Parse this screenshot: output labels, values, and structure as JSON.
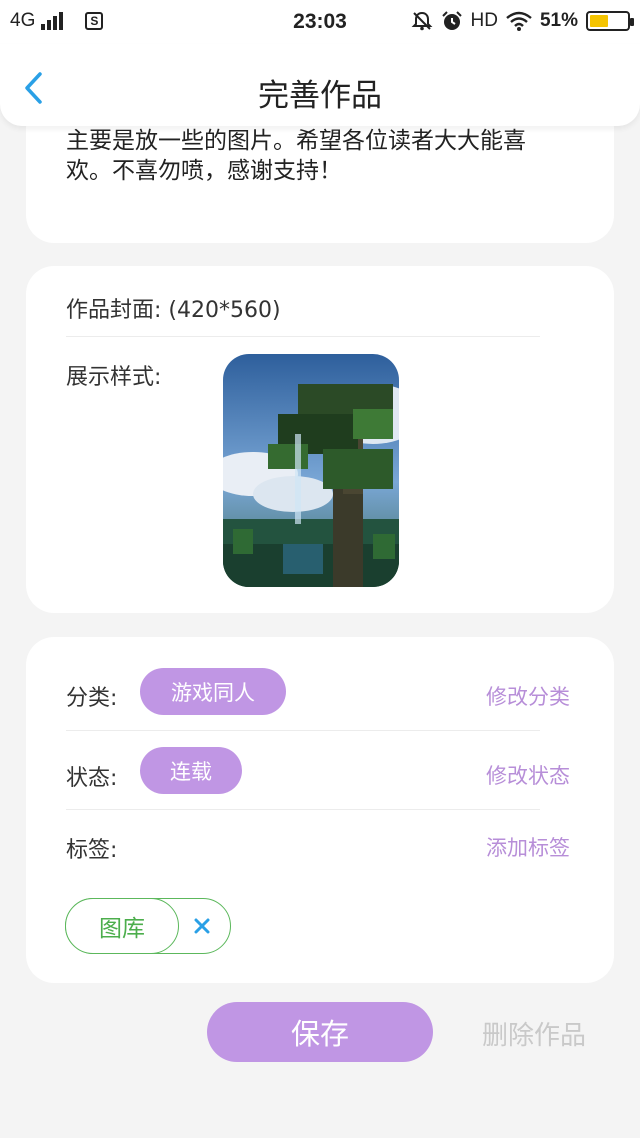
{
  "status_bar": {
    "network": "4G",
    "time": "23:03",
    "hd": "HD",
    "battery": "51%",
    "battery_level": 0.51,
    "notification_icon": "s-icon"
  },
  "nav": {
    "title": "完善作品",
    "back_icon": "chevron-left-icon"
  },
  "intro": {
    "text": "主要是放一些的图片。希望各位读者大大能喜欢。不喜勿喷，感谢支持！"
  },
  "cover": {
    "label": "作品封面: (420*560)",
    "style_label": "展示样式:"
  },
  "meta": {
    "category_label": "分类:",
    "category_value": "游戏同人",
    "category_action": "修改分类",
    "status_label": "状态:",
    "status_value": "连载",
    "status_action": "修改状态",
    "tags_label": "标签:",
    "tags_action": "添加标签",
    "tags": [
      {
        "label": "图库"
      }
    ]
  },
  "actions": {
    "save": "保存",
    "delete": "删除作品"
  },
  "colors": {
    "accent": "#c096e4",
    "link": "#b78ed8",
    "tag": "#5cb85c",
    "close": "#2aa0e6",
    "back": "#2aa0e6"
  }
}
